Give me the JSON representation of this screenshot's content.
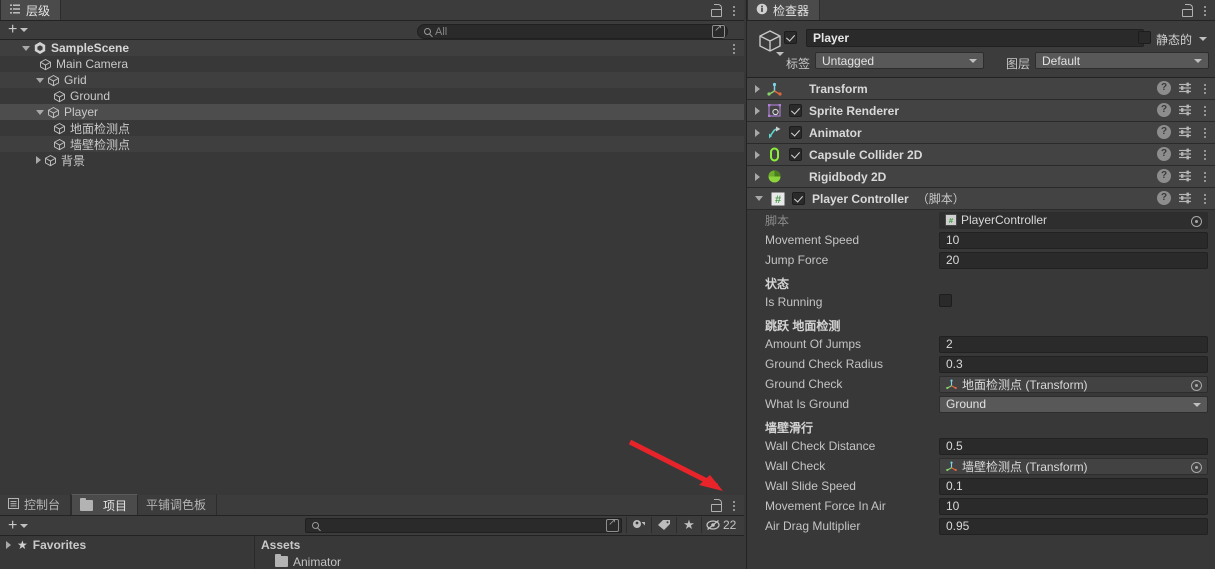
{
  "hierarchy": {
    "tab_label": "层级",
    "tab_icon": "hierarchy-icon",
    "search_placeholder": "All",
    "items": [
      {
        "label": "SampleScene",
        "depth": 0,
        "twisty": "down",
        "icon": "unity-scene-icon",
        "bold": true,
        "selected": false
      },
      {
        "label": "Main Camera",
        "depth": 1,
        "twisty": "none",
        "icon": "gameobject-cube-icon",
        "bold": false,
        "selected": false
      },
      {
        "label": "Grid",
        "depth": 1,
        "twisty": "down",
        "icon": "gameobject-cube-icon",
        "bold": false,
        "selected": false
      },
      {
        "label": "Ground",
        "depth": 2,
        "twisty": "none",
        "icon": "gameobject-cube-icon",
        "bold": false,
        "selected": false
      },
      {
        "label": "Player",
        "depth": 1,
        "twisty": "down",
        "icon": "gameobject-cube-icon",
        "bold": false,
        "selected": true
      },
      {
        "label": "地面检测点",
        "depth": 2,
        "twisty": "none",
        "icon": "gameobject-cube-icon",
        "bold": false,
        "selected": false
      },
      {
        "label": "墙壁检测点",
        "depth": 2,
        "twisty": "none",
        "icon": "gameobject-cube-icon",
        "bold": false,
        "selected": false
      },
      {
        "label": "背景",
        "depth": 1,
        "twisty": "right",
        "icon": "gameobject-cube-icon",
        "bold": false,
        "selected": false
      }
    ]
  },
  "project": {
    "tabs": [
      {
        "label": "控制台",
        "icon": "console-icon",
        "active": false
      },
      {
        "label": "项目",
        "icon": "folder-icon",
        "active": true
      },
      {
        "label": "平铺调色板",
        "icon": "none",
        "active": false
      }
    ],
    "search_placeholder": "",
    "hidden_count": "22",
    "favorites_label": "Favorites",
    "assets_label": "Assets",
    "assets_first_child": "Animator"
  },
  "inspector": {
    "tab_label": "检查器",
    "tab_icon": "info-icon",
    "object_name": "Player",
    "object_enabled": true,
    "static_label": "静态的",
    "static_checked": false,
    "tag_label": "标签",
    "tag_value": "Untagged",
    "layer_label": "图层",
    "layer_value": "Default",
    "components": [
      {
        "name": "Transform",
        "suffix": "",
        "expanded": false,
        "has_toggle": false,
        "enabled": false,
        "icon": "transform-icon"
      },
      {
        "name": "Sprite Renderer",
        "suffix": "",
        "expanded": false,
        "has_toggle": true,
        "enabled": true,
        "icon": "sprite-renderer-icon"
      },
      {
        "name": "Animator",
        "suffix": "",
        "expanded": false,
        "has_toggle": true,
        "enabled": true,
        "icon": "animator-icon"
      },
      {
        "name": "Capsule Collider 2D",
        "suffix": "",
        "expanded": false,
        "has_toggle": true,
        "enabled": true,
        "icon": "capsule-collider-2d-icon"
      },
      {
        "name": "Rigidbody 2D",
        "suffix": "",
        "expanded": false,
        "has_toggle": false,
        "enabled": false,
        "icon": "rigidbody-2d-icon"
      },
      {
        "name": "Player Controller",
        "suffix": "（脚本）",
        "expanded": true,
        "has_toggle": true,
        "enabled": true,
        "icon": "script-icon"
      }
    ],
    "script_row": {
      "label": "脚本",
      "value": "PlayerController"
    },
    "properties": [
      {
        "kind": "number",
        "label": "Movement Speed",
        "value": "10"
      },
      {
        "kind": "number",
        "label": "Jump Force",
        "value": "20"
      },
      {
        "kind": "header",
        "label": "状态"
      },
      {
        "kind": "toggle",
        "label": "Is Running",
        "value": false
      },
      {
        "kind": "header",
        "label": "跳跃 地面检测"
      },
      {
        "kind": "number",
        "label": "Amount Of Jumps",
        "value": "2"
      },
      {
        "kind": "number",
        "label": "Ground Check Radius",
        "value": "0.3"
      },
      {
        "kind": "object",
        "label": "Ground Check",
        "value": "地面检测点 (Transform)"
      },
      {
        "kind": "popup",
        "label": "What Is Ground",
        "value": "Ground"
      },
      {
        "kind": "header",
        "label": "墙壁滑行"
      },
      {
        "kind": "number",
        "label": "Wall Check Distance",
        "value": "0.5"
      },
      {
        "kind": "object",
        "label": "Wall Check",
        "value": "墙壁检测点 (Transform)"
      },
      {
        "kind": "number",
        "label": "Wall Slide Speed",
        "value": "0.1"
      },
      {
        "kind": "number",
        "label": "Movement Force In Air",
        "value": "10"
      },
      {
        "kind": "number",
        "label": "Air Drag Multiplier",
        "value": "0.95"
      }
    ],
    "help_glyph": "?"
  },
  "annotation": {
    "type": "red-arrow",
    "color": "#e8242a"
  }
}
